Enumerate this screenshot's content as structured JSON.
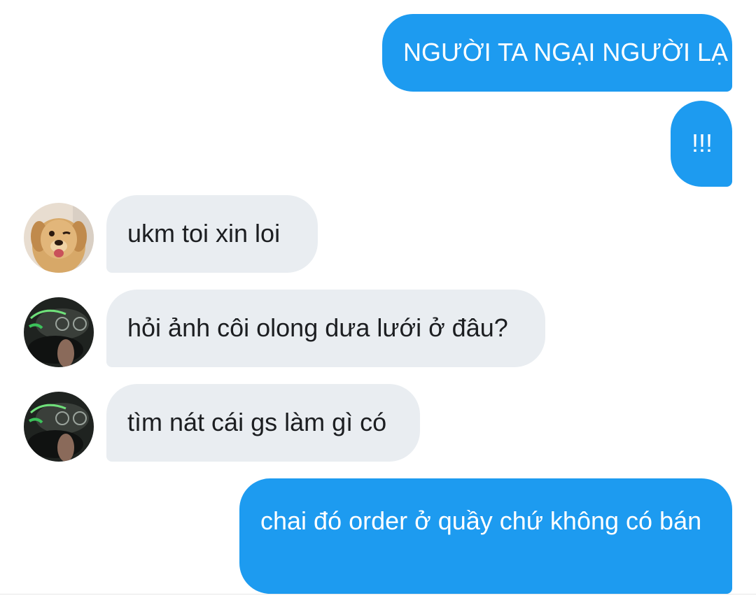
{
  "conversation": {
    "messages": [
      {
        "direction": "outgoing",
        "text": "NGƯỜI TA NGẠI NGƯỜI LẠ"
      },
      {
        "direction": "outgoing",
        "text": "!!!"
      },
      {
        "direction": "incoming",
        "sender_avatar": "dog-avatar",
        "text": "ukm toi xin loi"
      },
      {
        "direction": "incoming",
        "sender_avatar": "person-avatar",
        "text": "hỏi ảnh côi olong dưa lưới ở đâu?"
      },
      {
        "direction": "incoming",
        "sender_avatar": "person-avatar",
        "text": "tìm nát cái gs làm gì có"
      },
      {
        "direction": "outgoing",
        "text": "chai đó order ở quầy chứ không có bán"
      }
    ]
  },
  "colors": {
    "outgoing_bubble": "#1d9bf0",
    "incoming_bubble": "#e9edf1",
    "background": "#ffffff"
  }
}
